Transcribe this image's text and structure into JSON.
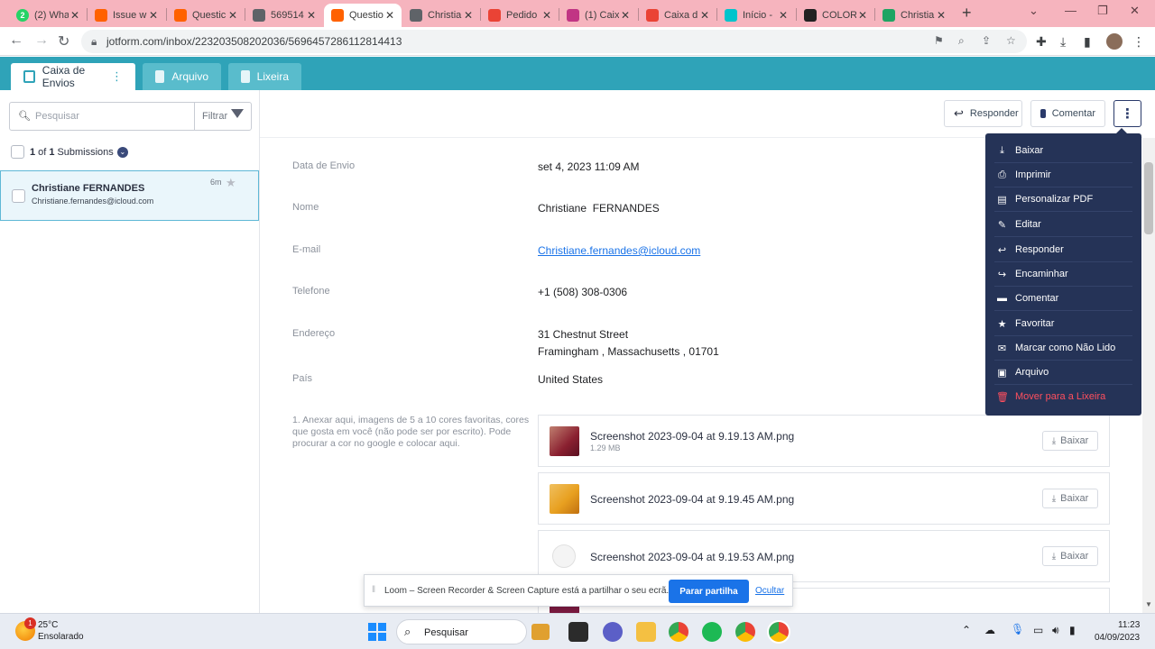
{
  "browser": {
    "tabs": [
      {
        "title": "(2) Wha",
        "icon": "whatsapp-icon",
        "color": "#25d366",
        "badge": "2"
      },
      {
        "title": "Issue w",
        "icon": "jotform-icon",
        "color": "#ff6100"
      },
      {
        "title": "Questic",
        "icon": "jotform-icon",
        "color": "#ff6100"
      },
      {
        "title": "569514",
        "icon": "globe-icon",
        "color": "#5f6368"
      },
      {
        "title": "Questio",
        "icon": "jotform-icon",
        "color": "#ff6100",
        "active": true
      },
      {
        "title": "Christia",
        "icon": "globe-icon",
        "color": "#5f6368"
      },
      {
        "title": "Pedido",
        "icon": "gmail-icon",
        "color": "#ea4335"
      },
      {
        "title": "(1) Caix",
        "icon": "instagram-icon",
        "color": "#c13584"
      },
      {
        "title": "Caixa d",
        "icon": "gmail-icon",
        "color": "#ea4335"
      },
      {
        "title": "Início -",
        "icon": "canva-icon",
        "color": "#00c4cc"
      },
      {
        "title": "COLOR",
        "icon": "colorwise-icon",
        "color": "#222222"
      },
      {
        "title": "Christia",
        "icon": "drive-icon",
        "color": "#1fa463"
      }
    ],
    "url": "jotform.com/inbox/223203508202036/5696457286112814413"
  },
  "jotform": {
    "header_tabs": [
      {
        "label": "Caixa de Envios",
        "active": true
      },
      {
        "label": "Arquivo",
        "active": false
      },
      {
        "label": "Lixeira",
        "active": false
      }
    ],
    "search_placeholder": "Pesquisar",
    "filter_label": "Filtrar",
    "submission_count": {
      "count": "1",
      "of": "of",
      "total": "1",
      "label": "Submissions"
    },
    "submission": {
      "name": "Christiane FERNANDES",
      "email": "Christiane.fernandes@icloud.com",
      "age": "6m"
    },
    "actions": {
      "reply": "Responder",
      "comment": "Comentar"
    },
    "fields": [
      {
        "label": "Data de Envio",
        "value": "set 4, 2023 11:09 AM"
      },
      {
        "label": "Nome",
        "value": "Christiane  FERNANDES"
      },
      {
        "label": "E-mail",
        "value": "Christiane.fernandes@icloud.com"
      },
      {
        "label": "Telefone",
        "value": "+1 (508) 308-0306"
      },
      {
        "label": "Endereço",
        "value": "31 Chestnut Street",
        "value2": "Framingham , Massachusetts , 01701"
      },
      {
        "label": "País",
        "value": "United States"
      }
    ],
    "upload_question": "1. Anexar aqui, imagens de 5 a 10 cores favoritas, cores que gosta em você (não pode ser por escrito). Pode procurar a cor no google e colocar aqui.",
    "files": [
      {
        "name": "Screenshot 2023-09-04 at 9.19.13 AM.png",
        "size": "1.29 MB",
        "thumb_color": "#8a2030"
      },
      {
        "name": "Screenshot 2023-09-04 at 9.19.45 AM.png",
        "size": "",
        "thumb_color": "#e8a020"
      },
      {
        "name": "Screenshot 2023-09-04 at 9.19.53 AM.png",
        "size": "",
        "thumb_color": "#f2f2f2"
      }
    ],
    "download_label": "Baixar",
    "menu": [
      {
        "label": "Baixar",
        "icon": "download-icon",
        "glyph": "⤓"
      },
      {
        "label": "Imprimir",
        "icon": "print-icon",
        "glyph": "⎙"
      },
      {
        "label": "Personalizar PDF",
        "icon": "pdf-icon",
        "glyph": "▤"
      },
      {
        "label": "Editar",
        "icon": "edit-icon",
        "glyph": "✎"
      },
      {
        "label": "Responder",
        "icon": "reply-icon",
        "glyph": "↩"
      },
      {
        "label": "Encaminhar",
        "icon": "forward-icon",
        "glyph": "↪"
      },
      {
        "label": "Comentar",
        "icon": "comment-icon",
        "glyph": "▬"
      },
      {
        "label": "Favoritar",
        "icon": "star-icon",
        "glyph": "★"
      },
      {
        "label": "Marcar como Não Lido",
        "icon": "envelope-icon",
        "glyph": "✉"
      },
      {
        "label": "Arquivo",
        "icon": "archive-icon",
        "glyph": "▣"
      },
      {
        "label": "Mover para a Lixeira",
        "icon": "trash-icon",
        "glyph": "🗑",
        "danger": true
      }
    ]
  },
  "loom": {
    "message": "Loom – Screen Recorder & Screen Capture está a partilhar o seu ecrã.",
    "stop_label": "Parar partilha",
    "hide_label": "Ocultar"
  },
  "taskbar": {
    "weather_temp": "25°C",
    "weather_desc": "Ensolarado",
    "weather_badge": "1",
    "search_label": "Pesquisar",
    "time": "11:23",
    "date": "04/09/2023"
  },
  "colors": {
    "jotform_header": "#2fa3b8",
    "menu_bg": "#253357",
    "danger": "#ff4f5e",
    "link": "#1a73e8",
    "tabstrip": "#f6b4be"
  }
}
